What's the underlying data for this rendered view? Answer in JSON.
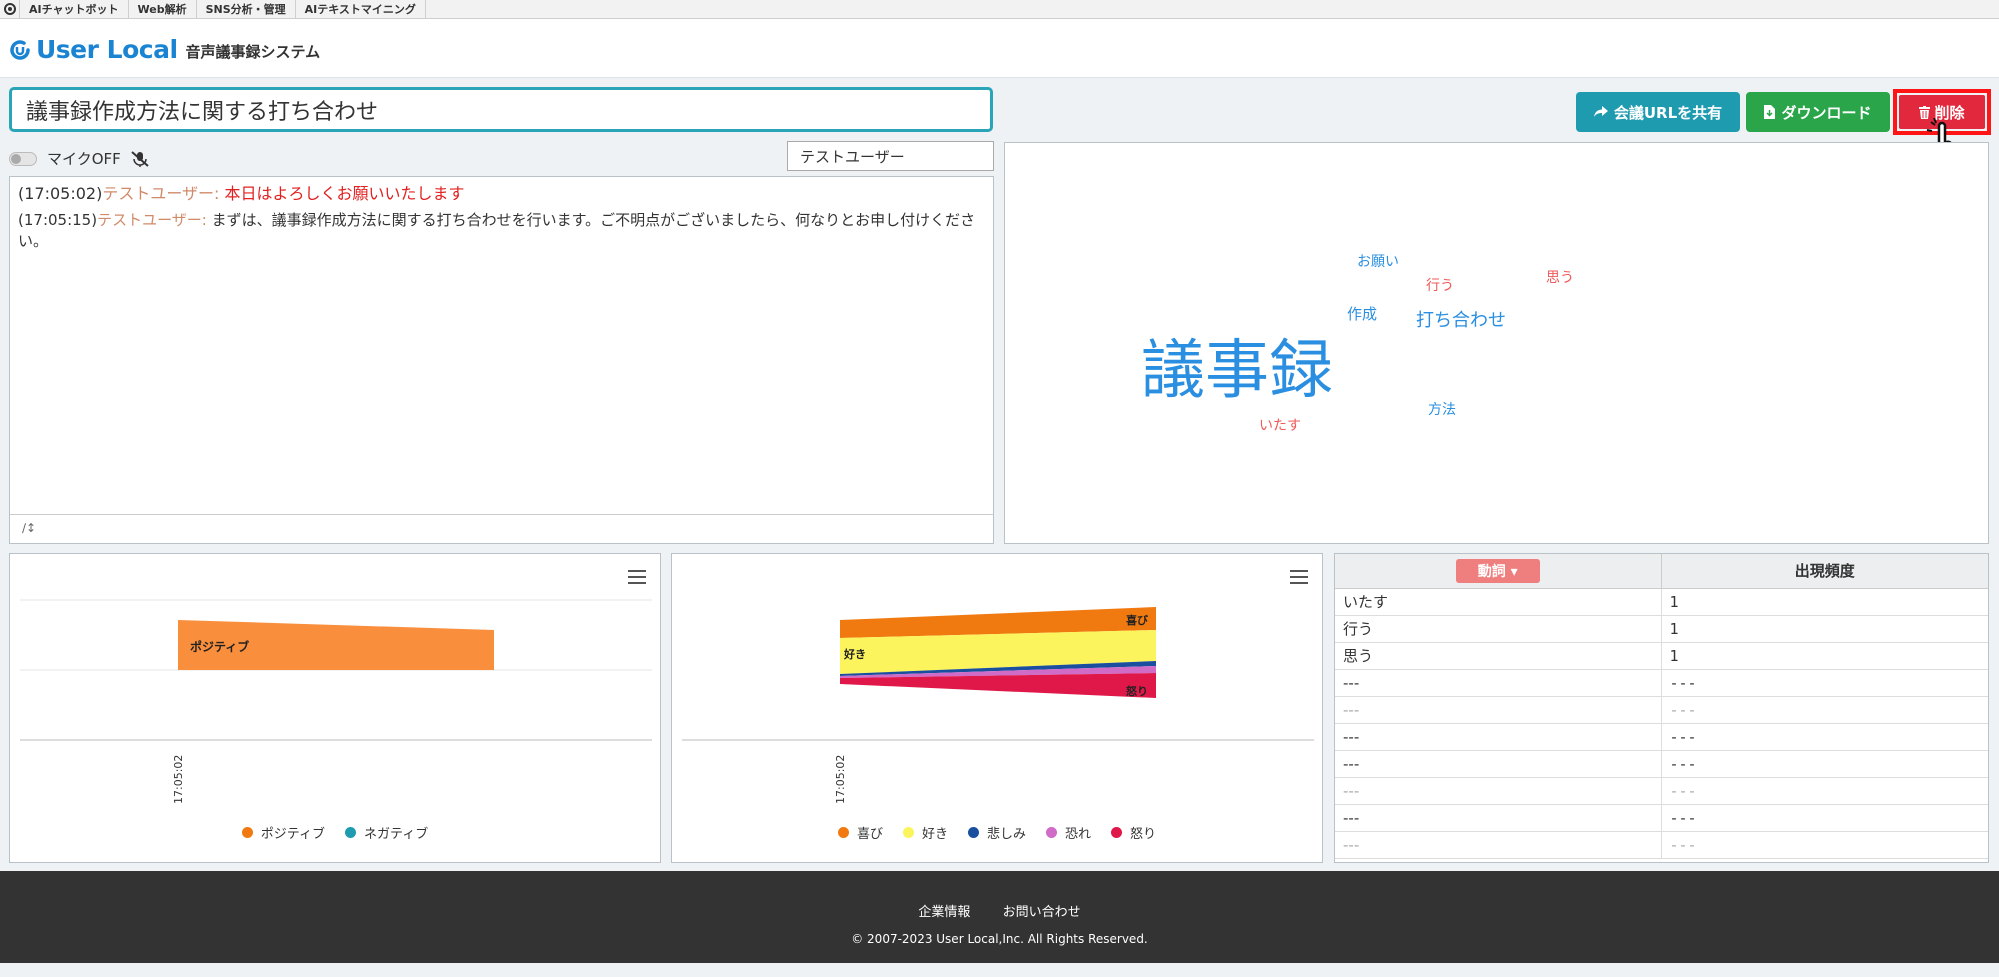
{
  "topbar": {
    "items": [
      "AIチャットボット",
      "Web解析",
      "SNS分析・管理",
      "AIテキストマイニング"
    ]
  },
  "header": {
    "brand": "User Local",
    "subtitle": "音声議事録システム"
  },
  "meeting": {
    "title": "議事録作成方法に関する打ち合わせ"
  },
  "buttons": {
    "share": "会議URLを共有",
    "download": "ダウンロード",
    "delete": "削除"
  },
  "mic": {
    "label": "マイクOFF",
    "user": "テストユーザー"
  },
  "transcript": {
    "lines": [
      {
        "time": "(17:05:02)",
        "user": "テストユーザー:",
        "text": "本日はよろしくお願いいたします"
      },
      {
        "time": "(17:05:15)",
        "user": "テストユーザー:",
        "text": "まずは、議事録作成方法に関する打ち合わせを行います。ご不明点がございましたら、何なりとお申し付けください。"
      }
    ],
    "footer": "∕↕"
  },
  "wordcloud": {
    "words": [
      {
        "text": "お願い",
        "color": "#2a8fe0"
      },
      {
        "text": "行う",
        "color": "#ef5a5a"
      },
      {
        "text": "思う",
        "color": "#ef5a5a"
      },
      {
        "text": "作成",
        "color": "#2a8fe0"
      },
      {
        "text": "打ち合わせ",
        "color": "#2a8fe0"
      },
      {
        "text": "議事録",
        "color": "#2a8fe0"
      },
      {
        "text": "方法",
        "color": "#2a8fe0"
      },
      {
        "text": "いたす",
        "color": "#ef5a5a"
      }
    ]
  },
  "chart_data": [
    {
      "type": "area",
      "x": [
        "17:05:02"
      ],
      "series": [
        {
          "name": "ポジティブ",
          "color": "#f98e3c",
          "label": "ポジティブ"
        },
        {
          "name": "ネガティブ",
          "color": "#1f9bb0"
        }
      ],
      "legend": "bottom"
    },
    {
      "type": "area",
      "x": [
        "17:05:02"
      ],
      "series": [
        {
          "name": "喜び",
          "color": "#f07a10",
          "label": "喜び"
        },
        {
          "name": "好き",
          "color": "#fbf45c",
          "label": "好き"
        },
        {
          "name": "悲しみ",
          "color": "#1a4fa0"
        },
        {
          "name": "恐れ",
          "color": "#d06bc8"
        },
        {
          "name": "怒り",
          "color": "#e0184a",
          "label": "怒り"
        }
      ],
      "legend": "bottom"
    }
  ],
  "frequency": {
    "filter_label": "動詞",
    "header": "出現頻度",
    "rows": [
      {
        "word": "いたす",
        "count": "1",
        "muted": false
      },
      {
        "word": "行う",
        "count": "1",
        "muted": false
      },
      {
        "word": "思う",
        "count": "1",
        "muted": false
      },
      {
        "word": "---",
        "count": "---",
        "muted": false
      },
      {
        "word": "---",
        "count": "---",
        "muted": true
      },
      {
        "word": "---",
        "count": "---",
        "muted": false
      },
      {
        "word": "---",
        "count": "---",
        "muted": false
      },
      {
        "word": "---",
        "count": "---",
        "muted": true
      },
      {
        "word": "---",
        "count": "---",
        "muted": false
      },
      {
        "word": "---",
        "count": "---",
        "muted": true
      }
    ]
  },
  "footer": {
    "company": "企業情報",
    "contact": "お問い合わせ",
    "copyright": "© 2007-2023 User Local,Inc. All Rights Reserved."
  }
}
